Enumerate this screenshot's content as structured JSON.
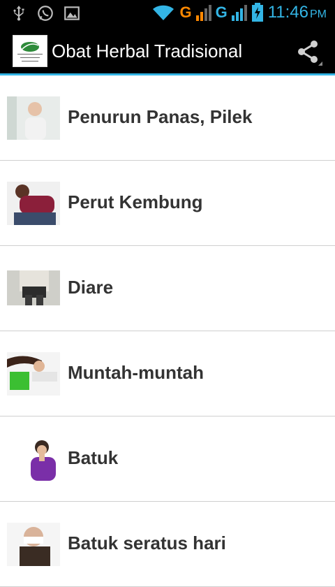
{
  "status_bar": {
    "left_icons": [
      "usb-icon",
      "whatsapp-icon",
      "image-icon"
    ],
    "network_labels": [
      "G",
      "G"
    ],
    "time": "11:46",
    "ampm": "PM",
    "colors": {
      "accent": "#33b5e5",
      "network_g": "#ff8800"
    }
  },
  "action_bar": {
    "title": "Obat Herbal Tradisional",
    "logo_text": "Obat Herbal Tradisional",
    "share_icon": "share-icon"
  },
  "list": {
    "items": [
      {
        "label": "Penurun Panas, Pilek"
      },
      {
        "label": "Perut Kembung"
      },
      {
        "label": "Diare"
      },
      {
        "label": "Muntah-muntah"
      },
      {
        "label": "Batuk"
      },
      {
        "label": "Batuk seratus hari"
      }
    ]
  }
}
